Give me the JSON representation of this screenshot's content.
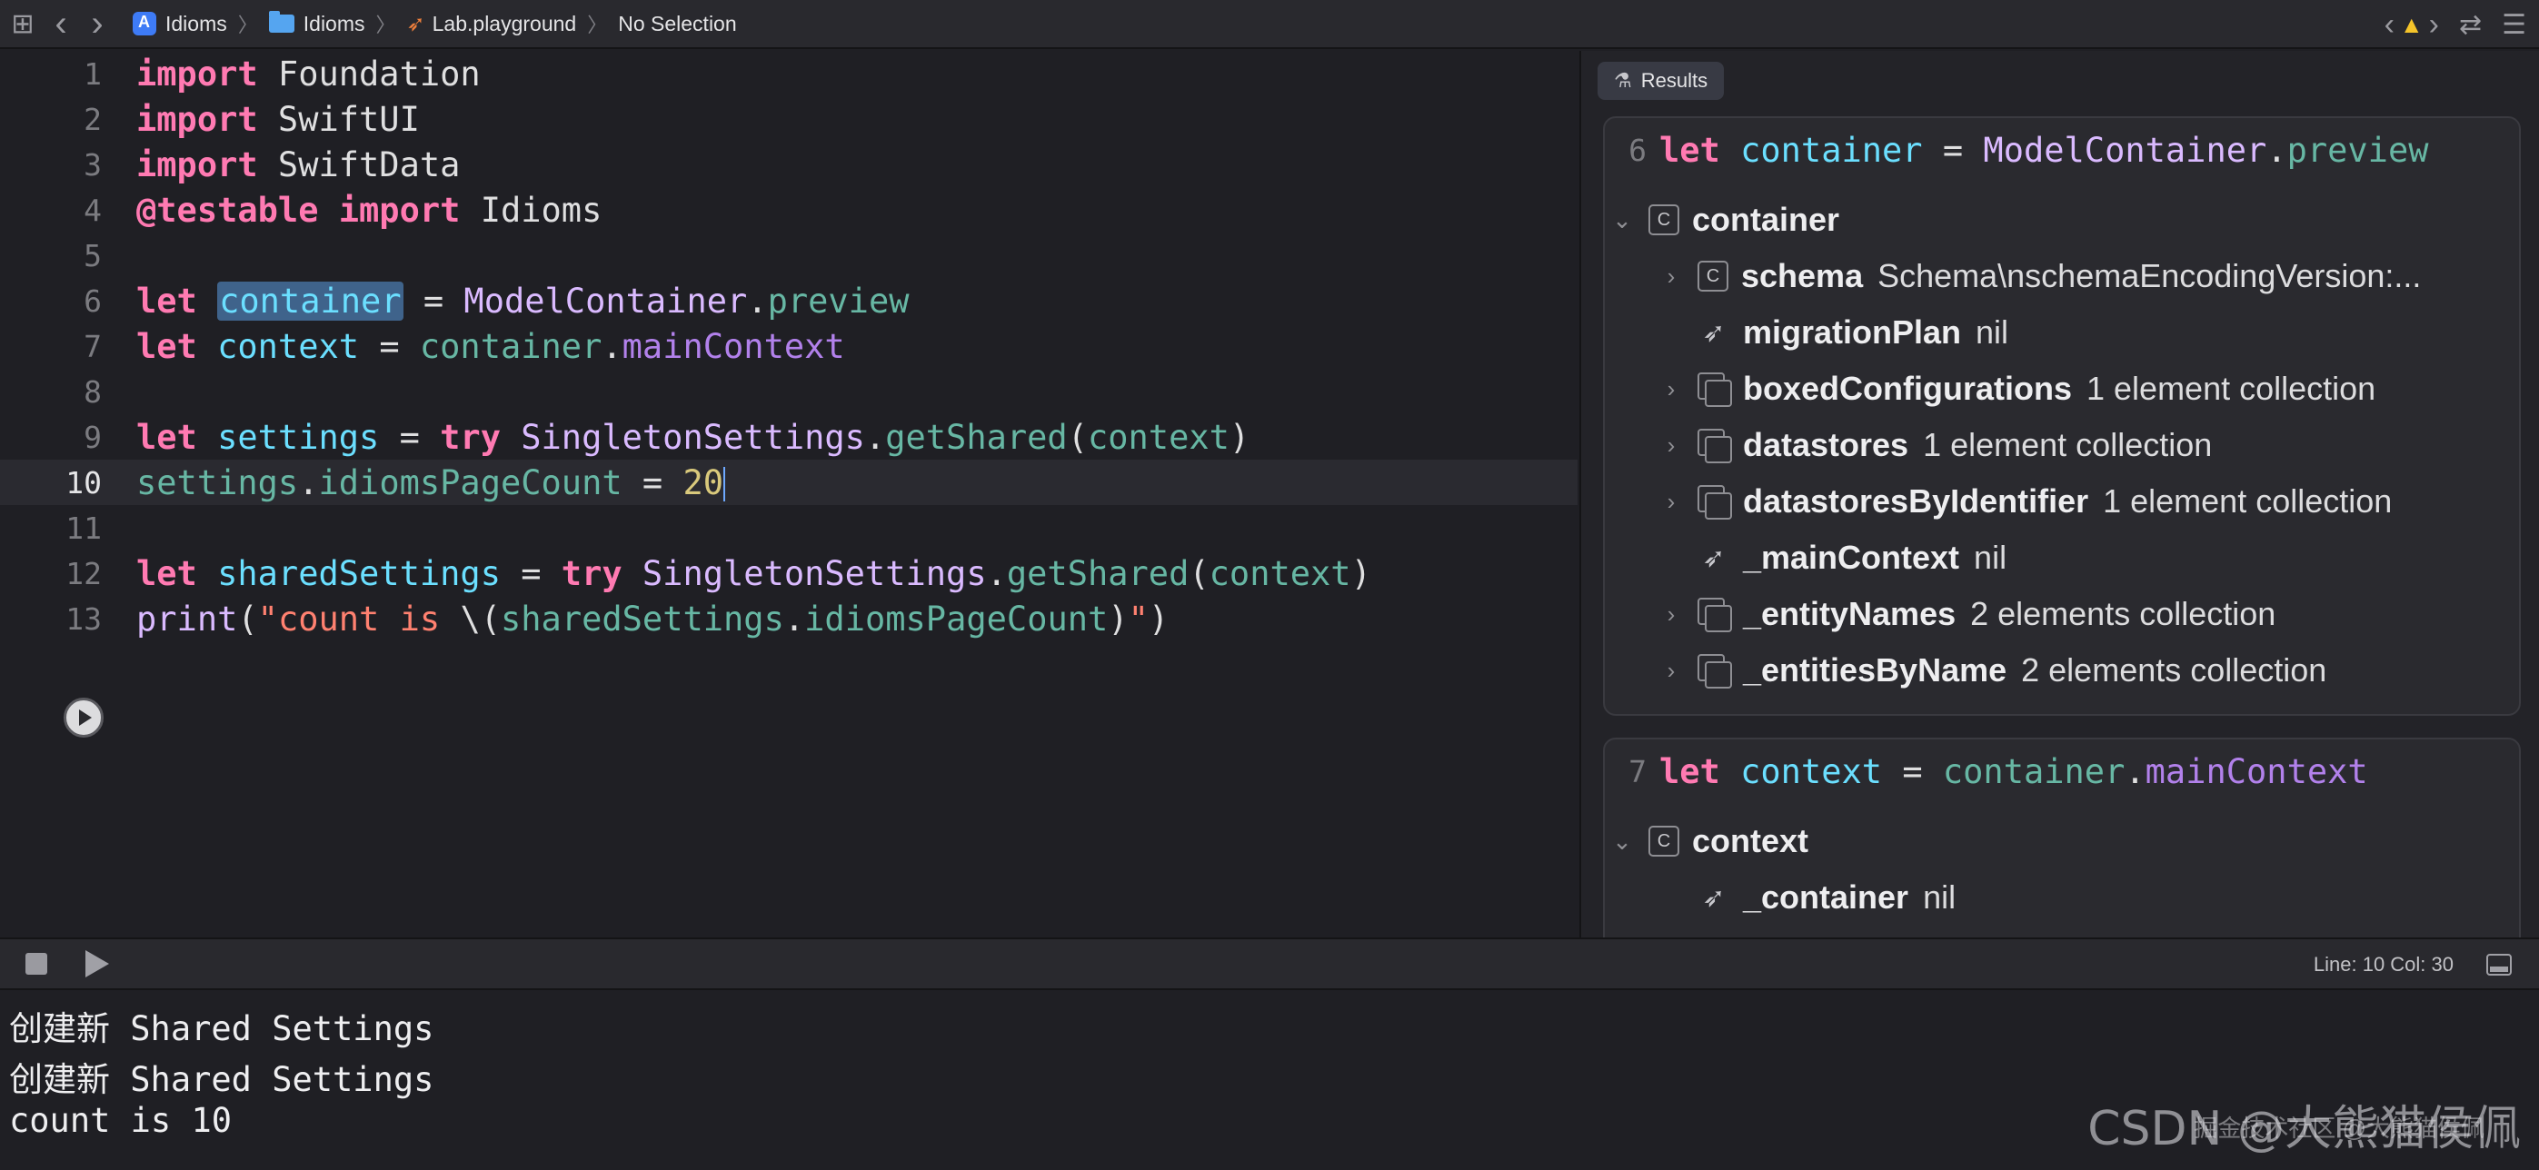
{
  "breadcrumbs": [
    "Idioms",
    "Idioms",
    "Lab.playground",
    "No Selection"
  ],
  "toolbar": {
    "back": "‹",
    "forward": "›",
    "grid": "⊞",
    "warn_prev": "‹",
    "warn_next": "›",
    "warn": "▲",
    "swap": "⇄",
    "menu": "☰"
  },
  "code_lines": [
    {
      "num": "1"
    },
    {
      "num": "2"
    },
    {
      "num": "3"
    },
    {
      "num": "4"
    },
    {
      "num": "5"
    },
    {
      "num": "6"
    },
    {
      "num": "7"
    },
    {
      "num": "8"
    },
    {
      "num": "9"
    },
    {
      "num": "10"
    },
    {
      "num": "11"
    },
    {
      "num": "12"
    },
    {
      "num": "13"
    }
  ],
  "code": {
    "l1_kw": "import",
    "l1_mod": " Foundation",
    "l2_kw": "import",
    "l2_mod": " SwiftUI",
    "l3_kw": "import",
    "l3_mod": " SwiftData",
    "l4_attr": "@testable",
    "l4_kw": " import",
    "l4_mod": " Idioms",
    "l6_kw": "let",
    "l6_var": "container",
    "l6_eq": " = ",
    "l6_type": "ModelContainer",
    "l6_dot": ".",
    "l6_prop": "preview",
    "l7_kw": "let",
    "l7_var": " context",
    "l7_eq": " = ",
    "l7_obj": "container",
    "l7_dot": ".",
    "l7_prop": "mainContext",
    "l9_kw": "let",
    "l9_var": " settings",
    "l9_eq": " = ",
    "l9_try": "try",
    "l9_type": " SingletonSettings",
    "l9_dot": ".",
    "l9_meth": "getShared",
    "l9_open": "(",
    "l9_arg": "context",
    "l9_close": ")",
    "l10_obj": "settings",
    "l10_dot": ".",
    "l10_prop": "idiomsPageCount",
    "l10_eq": " = ",
    "l10_num": "20",
    "l12_kw": "let",
    "l12_var": " sharedSettings",
    "l12_eq": " = ",
    "l12_try": "try",
    "l12_type": " SingletonSettings",
    "l12_dot": ".",
    "l12_meth": "getShared",
    "l12_open": "(",
    "l12_arg": "context",
    "l12_close": ")",
    "l13_fn": "print",
    "l13_open": "(",
    "l13_str1": "\"count is ",
    "l13_interp_open": "\\(",
    "l13_obj": "sharedSettings",
    "l13_dot": ".",
    "l13_prop": "idiomsPageCount",
    "l13_interp_close": ")",
    "l13_str2": "\"",
    "l13_close": ")"
  },
  "results": {
    "tab_label": "Results",
    "card1": {
      "line": "6",
      "head_kw": "let",
      "head_var": " container",
      "head_eq": " = ",
      "head_type": "ModelContainer",
      "head_dot": ".",
      "head_prop": "preview",
      "root_name": "container",
      "rows": [
        {
          "name": "schema",
          "value": "Schema\\nschemaEncodingVersion:..."
        },
        {
          "name": "migrationPlan",
          "value": "nil"
        },
        {
          "name": "boxedConfigurations",
          "value": "1 element collection"
        },
        {
          "name": "datastores",
          "value": "1 element collection"
        },
        {
          "name": "datastoresByIdentifier",
          "value": "1 element collection"
        },
        {
          "name": "_mainContext",
          "value": "nil"
        },
        {
          "name": "_entityNames",
          "value": "2 elements collection"
        },
        {
          "name": "_entitiesByName",
          "value": "2 elements collection"
        }
      ]
    },
    "card2": {
      "line": "7",
      "head_kw": "let",
      "head_var": " context",
      "head_eq": " = ",
      "head_obj": "container",
      "head_dot": ".",
      "head_prop": "mainContext",
      "root_name": "context",
      "rows": [
        {
          "name": "_container",
          "value": "nil"
        }
      ]
    }
  },
  "status": {
    "line_col": "Line: 10  Col: 30"
  },
  "console": {
    "lines": [
      "创建新 Shared Settings",
      "创建新 Shared Settings",
      "count is 10"
    ]
  },
  "watermark": {
    "main": "CSDN @大熊猫侯佩",
    "sub": "掘金技术社区 @大熊猫侯佩"
  },
  "colors": {
    "keyword": "#ff7ab2",
    "type": "#dabaff",
    "property": "#67b7a4",
    "method": "#b281eb",
    "variable": "#6bdfff",
    "string": "#ff8170",
    "number": "#d9c97c",
    "background": "#1f1f24"
  }
}
